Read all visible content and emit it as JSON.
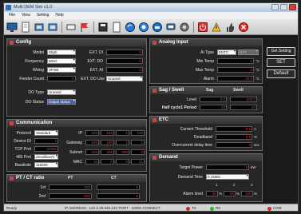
{
  "window": {
    "title": "Multi DEM Sim v1.0"
  },
  "menu": [
    "File",
    "View",
    "Setting",
    "Help"
  ],
  "toolbar": {
    "icons": [
      "monitor-icon",
      "document-icon",
      "connect-icon",
      "disconnect-icon",
      "network-icon",
      "flag-icon",
      "save-icon",
      "page-icon",
      "sync-icon",
      "refresh-icon",
      "chart-icon",
      "message-icon",
      "gear-icon",
      "shutdown-icon",
      "alarm-icon",
      "thumbs-icon",
      "close-icon"
    ]
  },
  "config": {
    "title": "Config",
    "model_label": "Model",
    "model_value": "3Sph",
    "frequency_label": "Frequency",
    "frequency_value": "60Hz",
    "wiring_label": "Wiring",
    "wiring_value": "3P4W",
    "feeder_label": "Feeder Count",
    "feeder_value": "0",
    "ext_di_label": "EXT. DI",
    "ext_di_value": "0",
    "ext_do_label": "EXT. DO",
    "ext_do_value": "0",
    "ext_ai_label": "EXT. AI",
    "ext_ai_value": "0",
    "ext_do_use_label": "EXT. DO Use",
    "ext_do_use_value": "Unused",
    "do_type_label": "DO Type",
    "do_type_value": "Unused",
    "do_status_label": "DO Status",
    "do_status_value": "Output status"
  },
  "communication": {
    "title": "Communication",
    "protocol_label": "Protocol",
    "protocol_value": "Standard",
    "device_id_label": "Device ID",
    "device_id_value": "1",
    "tcp_port_label": "TCP Port",
    "tcp_port_value": "10000",
    "port485_label": "485 Port",
    "port485_value": "ZmodbusAI",
    "baudrate_label": "Baudrate",
    "baudrate_value": "115200",
    "ip_label": "IP",
    "ip": [
      "192",
      "168",
      "1",
      "215"
    ],
    "gateway_label": "Gateway",
    "gateway": [
      "192",
      "168",
      "1",
      "1"
    ],
    "subnet_label": "Subnet",
    "subnet": [
      "255",
      "255",
      "255",
      "0"
    ],
    "mac_label": "MAC",
    "mac": [
      "10",
      "0",
      "0",
      "21"
    ]
  },
  "ptct": {
    "title": "PT / CT ratio",
    "pt_label": "PT",
    "ct_label": "CT",
    "first_label": "1st",
    "second_label": "2nd",
    "first_pt": "220",
    "first_ct": "5",
    "second_pt": "220",
    "second_ct": "5"
  },
  "analog": {
    "title": "Analog Input",
    "ai_type_label": "AI Type",
    "ai_type_value": "ENTC",
    "ai_type2_value": "NTC",
    "min_temp_label": "Min Temp",
    "min_temp_value": "0",
    "max_temp_label": "Max Temp",
    "max_temp_value": "0",
    "alarm_label": "Alarm",
    "alarm_value": "40.0",
    "unit_c": "°C",
    "get_setting": "Get Setting",
    "set": "SET",
    "default": "Default"
  },
  "sag": {
    "title": "Sag / Swell",
    "sag_col": "Sag",
    "swell_col": "Swell",
    "level_label": "Level",
    "level_sag": "0.0",
    "level_swell": "200.0",
    "period_label": "Half cycle1 Period",
    "period_sag": "20",
    "period_swell": "20"
  },
  "etc": {
    "title": "ETC",
    "current_threshold_label": "Current Threshold",
    "current_threshold_value": "0.1",
    "current_threshold_unit": "A",
    "deadband_label": "Deadband",
    "deadband_value": "0.5",
    "deadband_unit": "%",
    "overcurrent_label": "Overcurrent delay time",
    "overcurrent_value": "5",
    "overcurrent_unit": "sec"
  },
  "demand": {
    "title": "Demand",
    "target_label": "Target Power",
    "target_value": "3",
    "target_unit": "kW",
    "time_label": "Demand Time",
    "time_value": "0.15Min",
    "alarm_label": "Alarm level",
    "alarm_cols": [
      "1",
      "2",
      "3"
    ],
    "alarm_values": [
      "90",
      "95",
      "100"
    ],
    "alarm_unit": "%"
  },
  "status": {
    "ready": "Ready",
    "address": "IP ADDRESS : 122.2.29.246.14V  PORT : 10000   CONNECT",
    "tx": "TX",
    "rx": "RX",
    "com": "COM"
  },
  "colors": {
    "value_text": "#ee3333",
    "accent": "#3a66b8"
  }
}
